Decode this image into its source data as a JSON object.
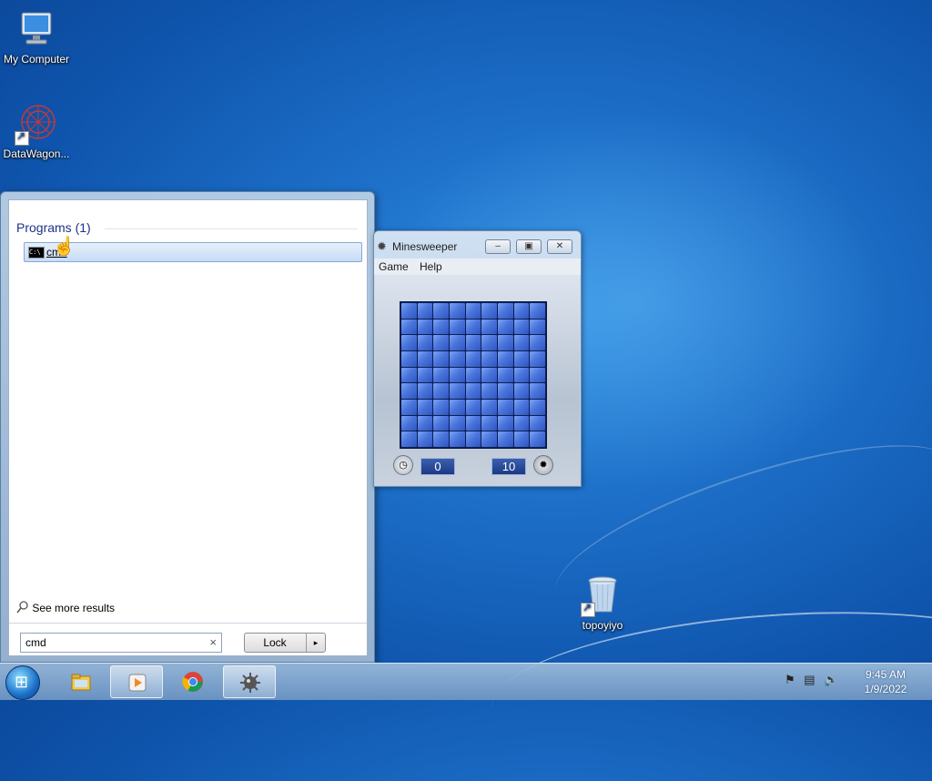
{
  "desktop": {
    "icons": [
      {
        "label": "My Computer",
        "icon": "computer-icon"
      },
      {
        "label": "DataWagon...",
        "icon": "datawagon-icon"
      },
      {
        "label": "topoyiyo",
        "icon": "recycle-bin-icon"
      }
    ]
  },
  "start_menu": {
    "section_title": "Programs (1)",
    "results": [
      {
        "label": "cmd",
        "icon": "cmd-icon"
      }
    ],
    "see_more_label": "See more results",
    "search": {
      "value": "cmd",
      "clear_glyph": "×"
    },
    "power_button_label": "Lock",
    "power_arrow_glyph": "▸"
  },
  "minesweeper": {
    "title": "Minesweeper",
    "menu": [
      "Game",
      "Help"
    ],
    "time_value": "0",
    "mines_value": "10",
    "grid_size": 9
  },
  "taskbar": {
    "pinned": [
      "windows-explorer-icon",
      "media-player-icon",
      "chrome-icon",
      "minesweeper-icon"
    ],
    "clock_time": "9:45 AM",
    "clock_date": "1/9/2022"
  }
}
